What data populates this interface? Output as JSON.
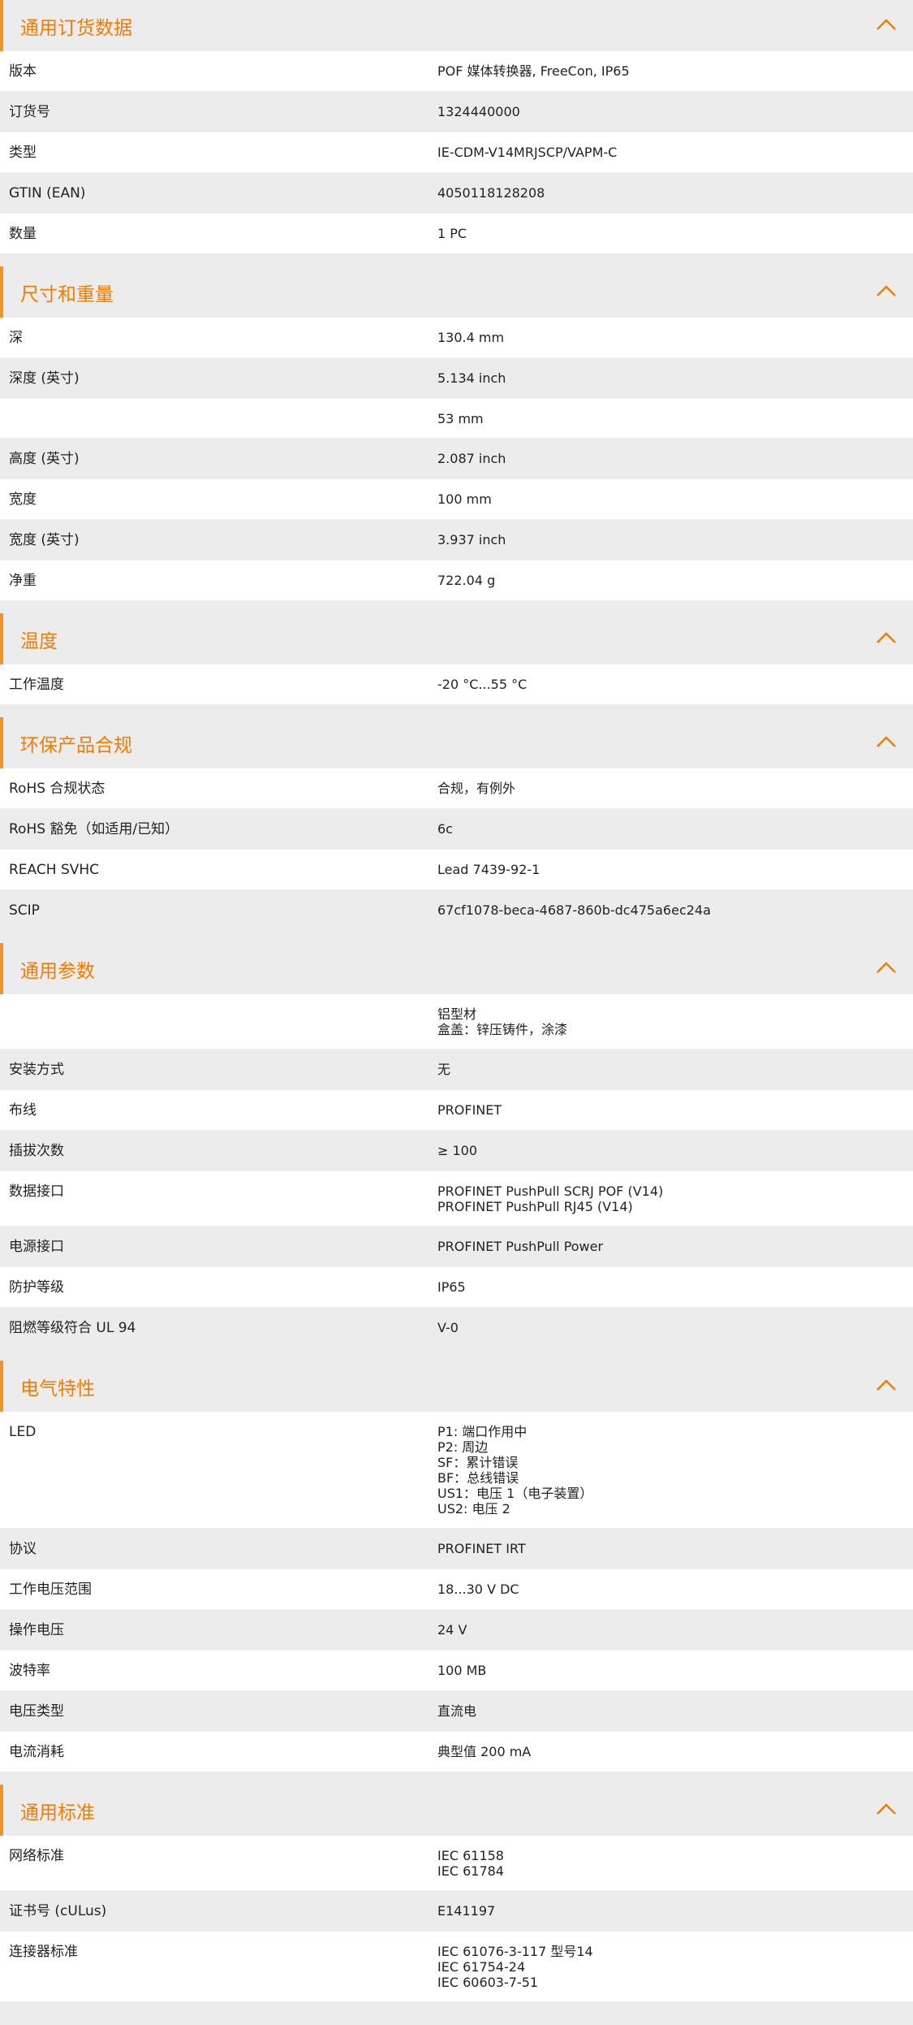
{
  "accent_color": "#f07d00",
  "chevron_icon": "chevron-up-icon",
  "sections": [
    {
      "title": "通用订货数据",
      "rows": [
        {
          "label": "版本",
          "value": "POF 媒体转换器, FreeCon, IP65"
        },
        {
          "label": "订货号",
          "value": "1324440000"
        },
        {
          "label": "类型",
          "value": "IE-CDM-V14MRJSCP/VAPM-C"
        },
        {
          "label": "GTIN (EAN)",
          "value": "4050118128208"
        },
        {
          "label": "数量",
          "value": "1  PC"
        }
      ]
    },
    {
      "title": "尺寸和重量",
      "rows": [
        {
          "label": "深",
          "value": "130.4  mm"
        },
        {
          "label": "深度 (英寸)",
          "value": "5.134  inch"
        },
        {
          "label": "",
          "value": "53  mm"
        },
        {
          "label": "高度 (英寸)",
          "value": "2.087  inch"
        },
        {
          "label": "宽度",
          "value": "100  mm"
        },
        {
          "label": "宽度 (英寸)",
          "value": "3.937  inch"
        },
        {
          "label": "净重",
          "value": "722.04  g"
        }
      ]
    },
    {
      "title": "温度",
      "rows": [
        {
          "label": "工作温度",
          "value": "-20 °C...55 °C"
        }
      ]
    },
    {
      "title": "环保产品合规",
      "rows": [
        {
          "label": "RoHS 合规状态",
          "value": "合规，有例外"
        },
        {
          "label": "RoHS 豁免（如适用/已知）",
          "value": "6c"
        },
        {
          "label": "REACH SVHC",
          "value": "Lead 7439-92-1"
        },
        {
          "label": "SCIP",
          "value": "67cf1078-beca-4687-860b-dc475a6ec24a"
        }
      ]
    },
    {
      "title": "通用参数",
      "rows": [
        {
          "label": "",
          "value": "铝型材\n盒盖：锌压铸件，涂漆"
        },
        {
          "label": "安装方式",
          "value": "无"
        },
        {
          "label": "布线",
          "value": "PROFINET"
        },
        {
          "label": "插拔次数",
          "value": "≥ 100"
        },
        {
          "label": "数据接口",
          "value": "PROFINET PushPull SCRJ POF (V14)\nPROFINET PushPull RJ45 (V14)"
        },
        {
          "label": "电源接口",
          "value": "PROFINET PushPull Power"
        },
        {
          "label": "防护等级",
          "value": "IP65"
        },
        {
          "label": "阻燃等级符合 UL 94",
          "value": "V-0"
        }
      ]
    },
    {
      "title": "电气特性",
      "rows": [
        {
          "label": "LED",
          "value": "P1: 端口作用中\nP2: 周边\nSF：累计错误\nBF：总线错误\nUS1：电压 1（电子装置）\nUS2: 电压 2"
        },
        {
          "label": "协议",
          "value": "PROFINET IRT"
        },
        {
          "label": "工作电压范围",
          "value": "18...30 V DC"
        },
        {
          "label": "操作电压",
          "value": "24  V"
        },
        {
          "label": "波特率",
          "value": "100 MB"
        },
        {
          "label": "电压类型",
          "value": "直流电"
        },
        {
          "label": "电流消耗",
          "value": "典型值 200 mA"
        }
      ]
    },
    {
      "title": "通用标准",
      "rows": [
        {
          "label": "网络标准",
          "value": "IEC 61158\nIEC 61784"
        },
        {
          "label": "证书号 (cULus)",
          "value": "E141197"
        },
        {
          "label": "连接器标准",
          "value": "IEC 61076-3-117 型号14\nIEC 61754-24\nIEC 60603-7-51"
        }
      ]
    }
  ]
}
